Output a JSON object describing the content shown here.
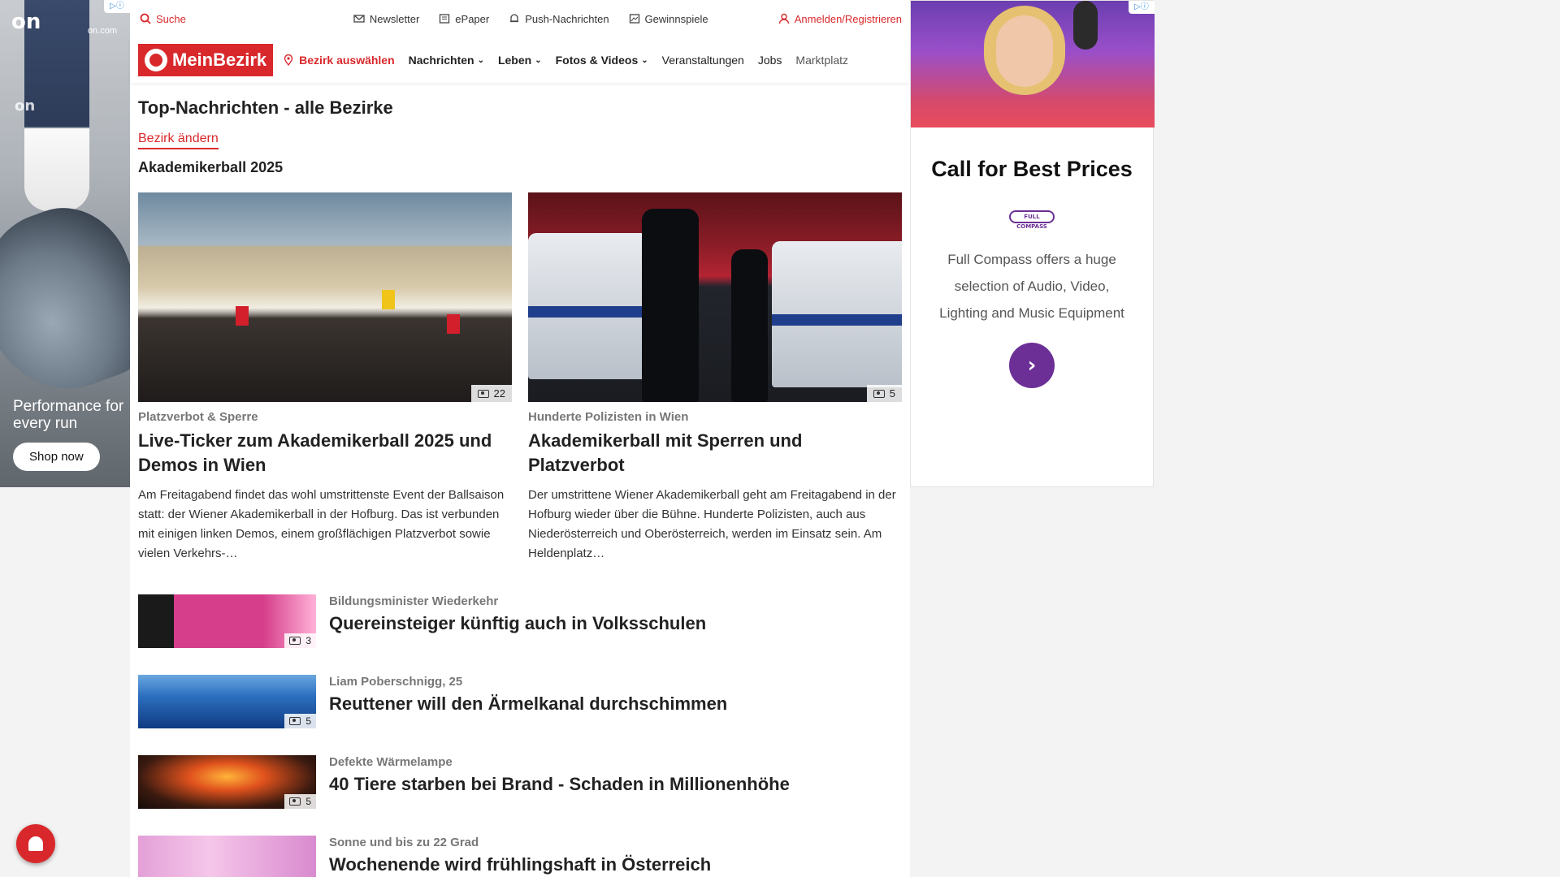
{
  "top_bar": {
    "search_label": "Suche",
    "links": [
      "Newsletter",
      "ePaper",
      "Push-Nachrichten",
      "Gewinnspiele"
    ],
    "login_label": "Anmelden/Registrieren"
  },
  "nav": {
    "logo": "MeinBezirk",
    "district_select": "Bezirk auswählen",
    "items": [
      "Nachrichten",
      "Leben",
      "Fotos & Videos",
      "Veranstaltungen",
      "Jobs",
      "Marktplatz"
    ]
  },
  "page": {
    "title": "Top-Nachrichten - alle Bezirke",
    "change_district": "Bezirk ändern",
    "section_title": "Akademikerball 2025"
  },
  "featured": [
    {
      "image_count": "22",
      "kicker": "Platzverbot & Sperre",
      "headline": "Live-Ticker zum Akademikerball 2025 und Demos in Wien",
      "excerpt": "Am Freitagabend findet das wohl umstrittenste Event der Ballsaison statt: der Wiener Akademikerball in der Hofburg. Das ist verbunden mit einigen linken Demos, einem großflächigen Platzverbot sowie vielen Verkehrs-…"
    },
    {
      "image_count": "5",
      "kicker": "Hunderte Polizisten in Wien",
      "headline": "Akademikerball mit Sperren und Platzverbot",
      "excerpt": "Der umstrittene Wiener Akademikerball geht am Freitagabend in der Hofburg wieder über die Bühne. Hunderte Polizisten, auch aus Niederösterreich und Oberösterreich, werden im Einsatz sein. Am Heldenplatz…"
    }
  ],
  "list": [
    {
      "image_count": "3",
      "kicker": "Bildungsminister Wiederkehr",
      "headline": "Quereinsteiger künftig auch in Volksschulen"
    },
    {
      "image_count": "5",
      "kicker": "Liam Poberschnigg, 25",
      "headline": "Reuttener will den Ärmelkanal durchschimmen"
    },
    {
      "image_count": "5",
      "kicker": "Defekte Wärmelampe",
      "headline": "40 Tiere starben bei Brand - Schaden in Millionenhöhe"
    },
    {
      "image_count": "",
      "kicker": "Sonne und bis zu 22 Grad",
      "headline": "Wochenende wird frühlingshaft in Österreich"
    }
  ],
  "ad_left": {
    "brand": "on",
    "domain": "on.com",
    "tagline": "Performance for every run",
    "cta": "Shop now"
  },
  "ad_right": {
    "title": "Call for Best Prices",
    "brand_mark": "FULL COMPASS",
    "description": "Full Compass offers a huge selection of Audio, Video, Lighting and Music Equipment"
  },
  "colors": {
    "brand_red": "#d9282b",
    "ad_purple": "#6b2f96"
  }
}
